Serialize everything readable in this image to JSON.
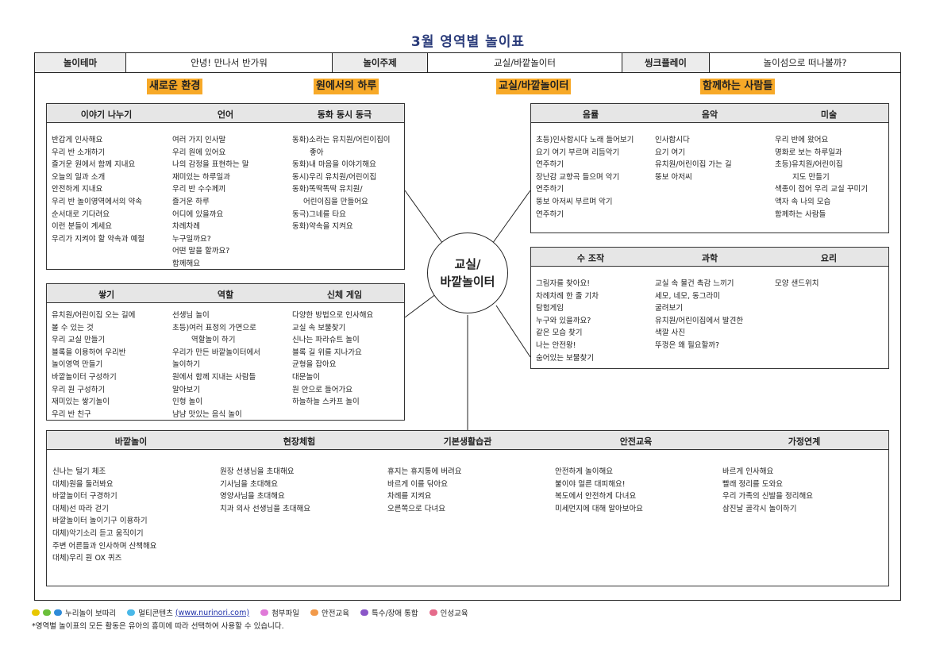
{
  "title": "3월 영역별 놀이표",
  "header": {
    "theme_label": "놀이테마",
    "theme_value": "안녕! 만나서 반가워",
    "topic_label": "놀이주제",
    "topic_value": "교실/바깥놀이터",
    "sync_label": "씽크플레이",
    "sync_value": "놀이섬으로 떠나볼까?"
  },
  "themes": [
    "새로운 환경",
    "원에서의 하루",
    "교실/바깥놀이터",
    "함께하는 사람들"
  ],
  "center": {
    "line1": "교실/",
    "line2": "바깥놀이터"
  },
  "boxes": {
    "lang": {
      "heads": [
        "이야기 나누기",
        "언어",
        "동화 동시 동극"
      ],
      "cols": [
        [
          "반갑게 인사해요",
          "우리 반 소개하기",
          "즐거운 원에서 함께 지내요",
          "오늘의 일과 소개",
          "안전하게 지내요",
          "우리 반 놀이영역에서의 약속",
          "순서대로 기다려요",
          "이런 분들이 계세요",
          "우리가 지켜야 할 약속과 예절"
        ],
        [
          "여러 가지 인사말",
          "우리 원에 있어요",
          "나의 감정을 표현하는 말",
          "재미있는 하루일과",
          "우리 반 수수께끼",
          "즐거운 하루",
          "어디에 있을까요",
          "차례차례",
          "누구일까요?",
          "어떤 말을 할까요?",
          "함께해요"
        ],
        [
          "동화)소라는 유치원/어린이집이",
          "좋아",
          "동화)내 마음을 이야기해요",
          "동시)우리 유치원/어린이집",
          "동화)똑딱똑딱 유치원/",
          "어린이집을 만들어요",
          "동극)그네를 타요",
          "동화)약속을 지켜요"
        ]
      ]
    },
    "music": {
      "heads": [
        "음률",
        "음악",
        "미술"
      ],
      "cols": [
        [
          "초등)인사합시다 노래 들어보기",
          "요기 여기 부르며 리듬악기",
          "연주하기",
          "장난감 교향곡 들으며 악기",
          "연주하기",
          "뚱보 아저씨 부르며 악기",
          "연주하기"
        ],
        [
          "인사합시다",
          "요기 여기",
          "유치원/어린이집 가는 길",
          "뚱보 아저씨"
        ],
        [
          "우리 반에 왔어요",
          "명화로 보는 하루일과",
          "초등)유치원/어린이집",
          "지도 만들기",
          "색종이 접어 우리 교실 꾸미기",
          "액자 속 나의 모습",
          "함께하는 사람들"
        ]
      ]
    },
    "build": {
      "heads": [
        "쌓기",
        "역할",
        "신체 게임"
      ],
      "cols": [
        [
          "유치원/어린이집 오는 길에",
          "볼 수 있는 것",
          "우리 교실 만들기",
          "블록을 이용하여 우리반",
          "놀이영역 만들기",
          "바깥놀이터 구성하기",
          "우리 원 구성하기",
          "재미있는 쌓기놀이",
          "우리 반 친구"
        ],
        [
          "선생님 놀이",
          "초등)여러 표정의 가면으로",
          "역할놀이 하기",
          "우리가 만든 바깥놀이터에서",
          "놀이하기",
          "원에서 함께 지내는 사람들",
          "알아보기",
          "인형 놀이",
          "냠냠 맛있는 음식 놀이"
        ],
        [
          "다양한 방법으로 인사해요",
          "교실 속 보물찾기",
          "신나는 파라슈트 놀이",
          "블록 길 위를 지나가요",
          "균형을 잡아요",
          "대문놀이",
          "원 안으로 들어가요",
          "하늘하늘 스카프 놀이"
        ]
      ]
    },
    "science": {
      "heads": [
        "수 조작",
        "과학",
        "요리"
      ],
      "cols": [
        [
          "그림자를 찾아요!",
          "차례차례 한 줄 기차",
          "탐험게임",
          "누구와 있을까요?",
          "같은 모습 찾기",
          "나는 안전왕!",
          "숨어있는 보물찾기"
        ],
        [
          "교실 속 물건 촉감 느끼기",
          "세모, 네모, 동그라미",
          "굴려보기",
          "유치원/어린이집에서 발견한",
          "색깔 사진",
          "뚜껑은 왜 필요할까?"
        ],
        [
          "모양 샌드위치"
        ]
      ]
    },
    "bottom": {
      "heads": [
        "바깥놀이",
        "현장체험",
        "기본생활습관",
        "안전교육",
        "가정연계"
      ],
      "cols": [
        [
          "신나는 털기 체조",
          "대체)원을 둘러봐요",
          "바깥놀이터 구경하기",
          "대체)선 따라 걷기",
          "바깥놀이터 놀이기구 이용하기",
          "대체)악기소리 듣고 움직이기",
          "주변 어른들과 인사하며 산책해요",
          "대체)우리 원 OX 퀴즈"
        ],
        [
          "원장 선생님을 초대해요",
          "기사님을 초대해요",
          "영양사님을 초대해요",
          "치과 의사 선생님을 초대해요"
        ],
        [
          "휴지는 휴지통에 버려요",
          "바르게 이를 닦아요",
          "차례를 지켜요",
          "오른쪽으로 다녀요"
        ],
        [
          "안전하게 놀이해요",
          "불이야 얼른 대피해요!",
          "복도에서 안전하게 다녀요",
          "미세먼지에 대해 알아보아요"
        ],
        [
          "바르게 인사해요",
          "빨래 정리를 도와요",
          "우리 가족의 신발을 정리해요",
          "삼진날 골각시 놀이하기"
        ]
      ]
    }
  },
  "legend": {
    "nuri": "누리놀이 보따리",
    "multi": "멀티콘텐츠",
    "url": "(www.nurinori.com)",
    "file": "첨부파일",
    "safety": "안전교육",
    "special": "특수/장애 통합",
    "character": "인성교육"
  },
  "footnote": "*영역별 놀이표의 모든 활동은 유아의 흥미에 따라 선택하여 사용할 수 있습니다.",
  "colors": {
    "theme_bg": "#f7a928",
    "head_bg": "#e6e6e6",
    "title": "#2a3b7a",
    "nuri_yellow": "#e8c700",
    "nuri_green": "#6bbf3b",
    "nuri_blue": "#2e8bd8",
    "multi": "#4ab8e8",
    "file": "#e07ad8",
    "safety": "#f29a4a",
    "special": "#8a56c8",
    "character": "#e56b8b"
  }
}
